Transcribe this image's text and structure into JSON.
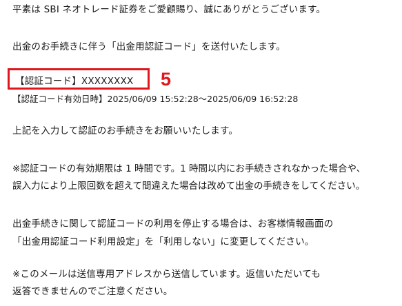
{
  "email": {
    "greeting": "平素は SBI ネオトレード証券をご愛顧賜り、誠にありがとうございます。",
    "intro": "出金のお手続きに伴う「出金用認証コード」を送付いたします。",
    "auth_code_line": "【認証コード】XXXXXXXX",
    "validity_line": "【認証コード有効日時】2025/06/09 15:52:28〜2025/06/09 16:52:28",
    "instruction": "上記を入力して認証のお手続きをお願いいたします。",
    "note_expiry_1": "※認証コードの有効期限は 1 時間です。1 時間以内にお手続きされなかった場合や、",
    "note_expiry_2": "誤入力により上限回数を超えて間違えた場合は改めて出金の手続きをしてください。",
    "settings_note_1": "出金手続きに関して認証コードの利用を停止する場合は、お客様情報画面の",
    "settings_note_2": "「出金用認証コード利用設定」を「利用しない」に変更してください。",
    "send_only_1": "※このメールは送信専用アドレスから送信しています。返信いただいても",
    "send_only_2": "返答できませんのでご注意ください。"
  },
  "annotation": {
    "step_number": "5",
    "color": "#e0161e"
  }
}
